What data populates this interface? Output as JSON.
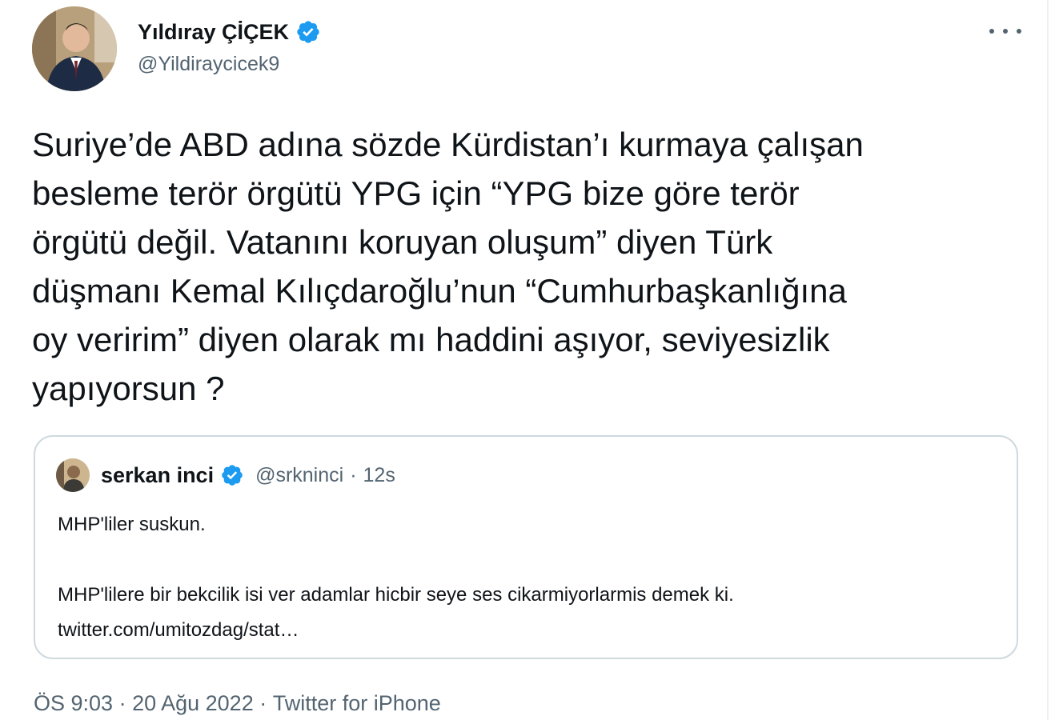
{
  "tweet": {
    "author": {
      "name": "Yıldıray ÇİÇEK",
      "handle": "@Yildiraycicek9",
      "verified": true,
      "avatar_icon": "profile-photo"
    },
    "more_icon": "more-horizontal-icon",
    "text": "Suriye’de ABD adına sözde Kürdistan’ı kurmaya çalışan\nbesleme terör örgütü YPG için “YPG bize göre terör\nörgütü değil. Vatanını koruyan oluşum” diyen Türk\ndüşmanı Kemal Kılıçdaroğlu’nun “Cumhurbaşkanlığına\noy veririm” diyen olarak mı haddini aşıyor, seviyesizlik\nyapıyorsun ?",
    "quoted": {
      "author_name": "serkan inci",
      "author_handle": "@srkninci",
      "separator": "·",
      "time": "12s",
      "verified": true,
      "lines": [
        "MHP'liler suskun.",
        "",
        "MHP'lilere bir bekcilik isi ver adamlar hicbir seye ses cikarmiyorlarmis demek ki.",
        "twitter.com/umitozdag/stat…"
      ]
    },
    "meta": {
      "time": "ÖS 9:03",
      "sep1": " · ",
      "date": "20 Ağu 2022",
      "sep2": " · ",
      "source": "Twitter for iPhone"
    }
  },
  "colors": {
    "text": "#0f1419",
    "secondary": "#536471",
    "verified": "#1d9bf0",
    "border": "#cfd9de"
  }
}
